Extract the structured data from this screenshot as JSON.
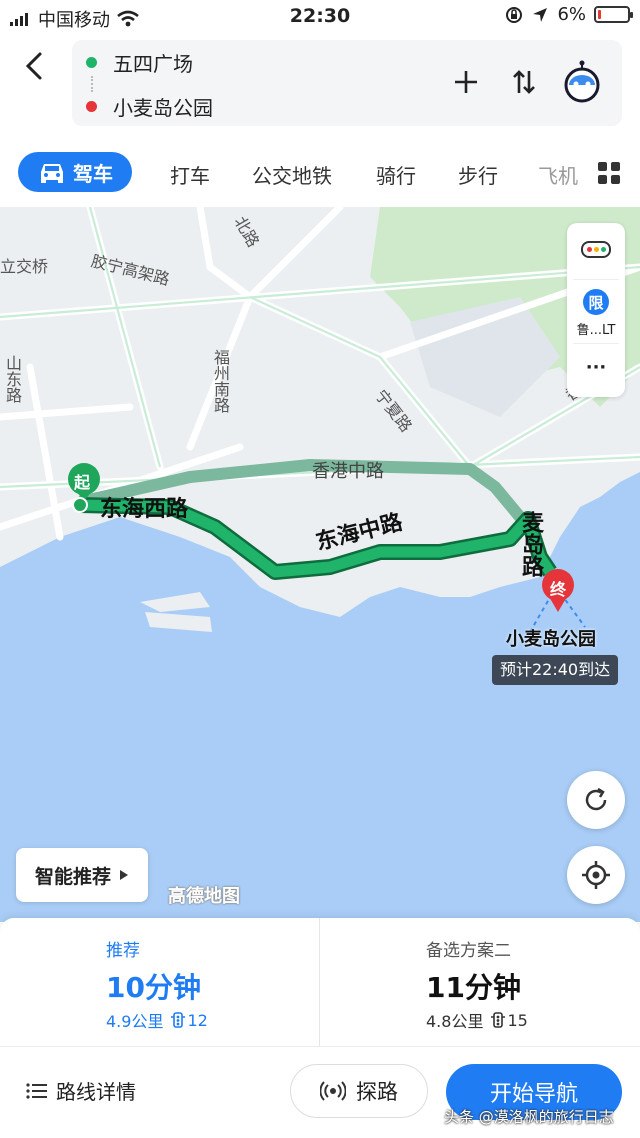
{
  "status_bar": {
    "carrier": "中国移动",
    "time": "22:30",
    "battery": "6%"
  },
  "route": {
    "origin": "五四广场",
    "destination": "小麦岛公园"
  },
  "tabs": [
    {
      "label": "驾车",
      "active": true
    },
    {
      "label": "打车"
    },
    {
      "label": "公交地铁"
    },
    {
      "label": "骑行"
    },
    {
      "label": "步行"
    },
    {
      "label": "飞机"
    }
  ],
  "map": {
    "road_labels": {
      "r1": "立交桥",
      "r2": "胶宁高架路",
      "r3": "北路",
      "r4": "福州南路",
      "r5": "山东路",
      "r6": "宁夏路",
      "r7": "香港中路",
      "r8": "香港",
      "route_road_1": "东海西路",
      "route_road_2": "东海中路",
      "route_road_3": "麦岛路"
    },
    "start_marker": "起",
    "end_marker": "终",
    "destination_label": "小麦岛公园",
    "eta_label": "预计22:40到达",
    "restriction_badge": "限",
    "restriction_plate": "鲁...LT",
    "more_label": "···",
    "provider": "高德地图",
    "smart_recommend": "智能推荐",
    "colors": {
      "route_primary": "#1aa260",
      "route_alt": "#86c4a8",
      "water": "#a9cdf6",
      "green_area": "#c9e8c6"
    }
  },
  "options": [
    {
      "label": "推荐",
      "duration": "10分钟",
      "distance": "4.9公里",
      "lights": "12",
      "selected": true
    },
    {
      "label": "备选方案二",
      "duration": "11分钟",
      "distance": "4.8公里",
      "lights": "15",
      "selected": false
    }
  ],
  "actions": {
    "details": "路线详情",
    "explore": "探路",
    "start": "开始导航"
  },
  "watermark": "头条 @漠洛枫的旅行日志"
}
